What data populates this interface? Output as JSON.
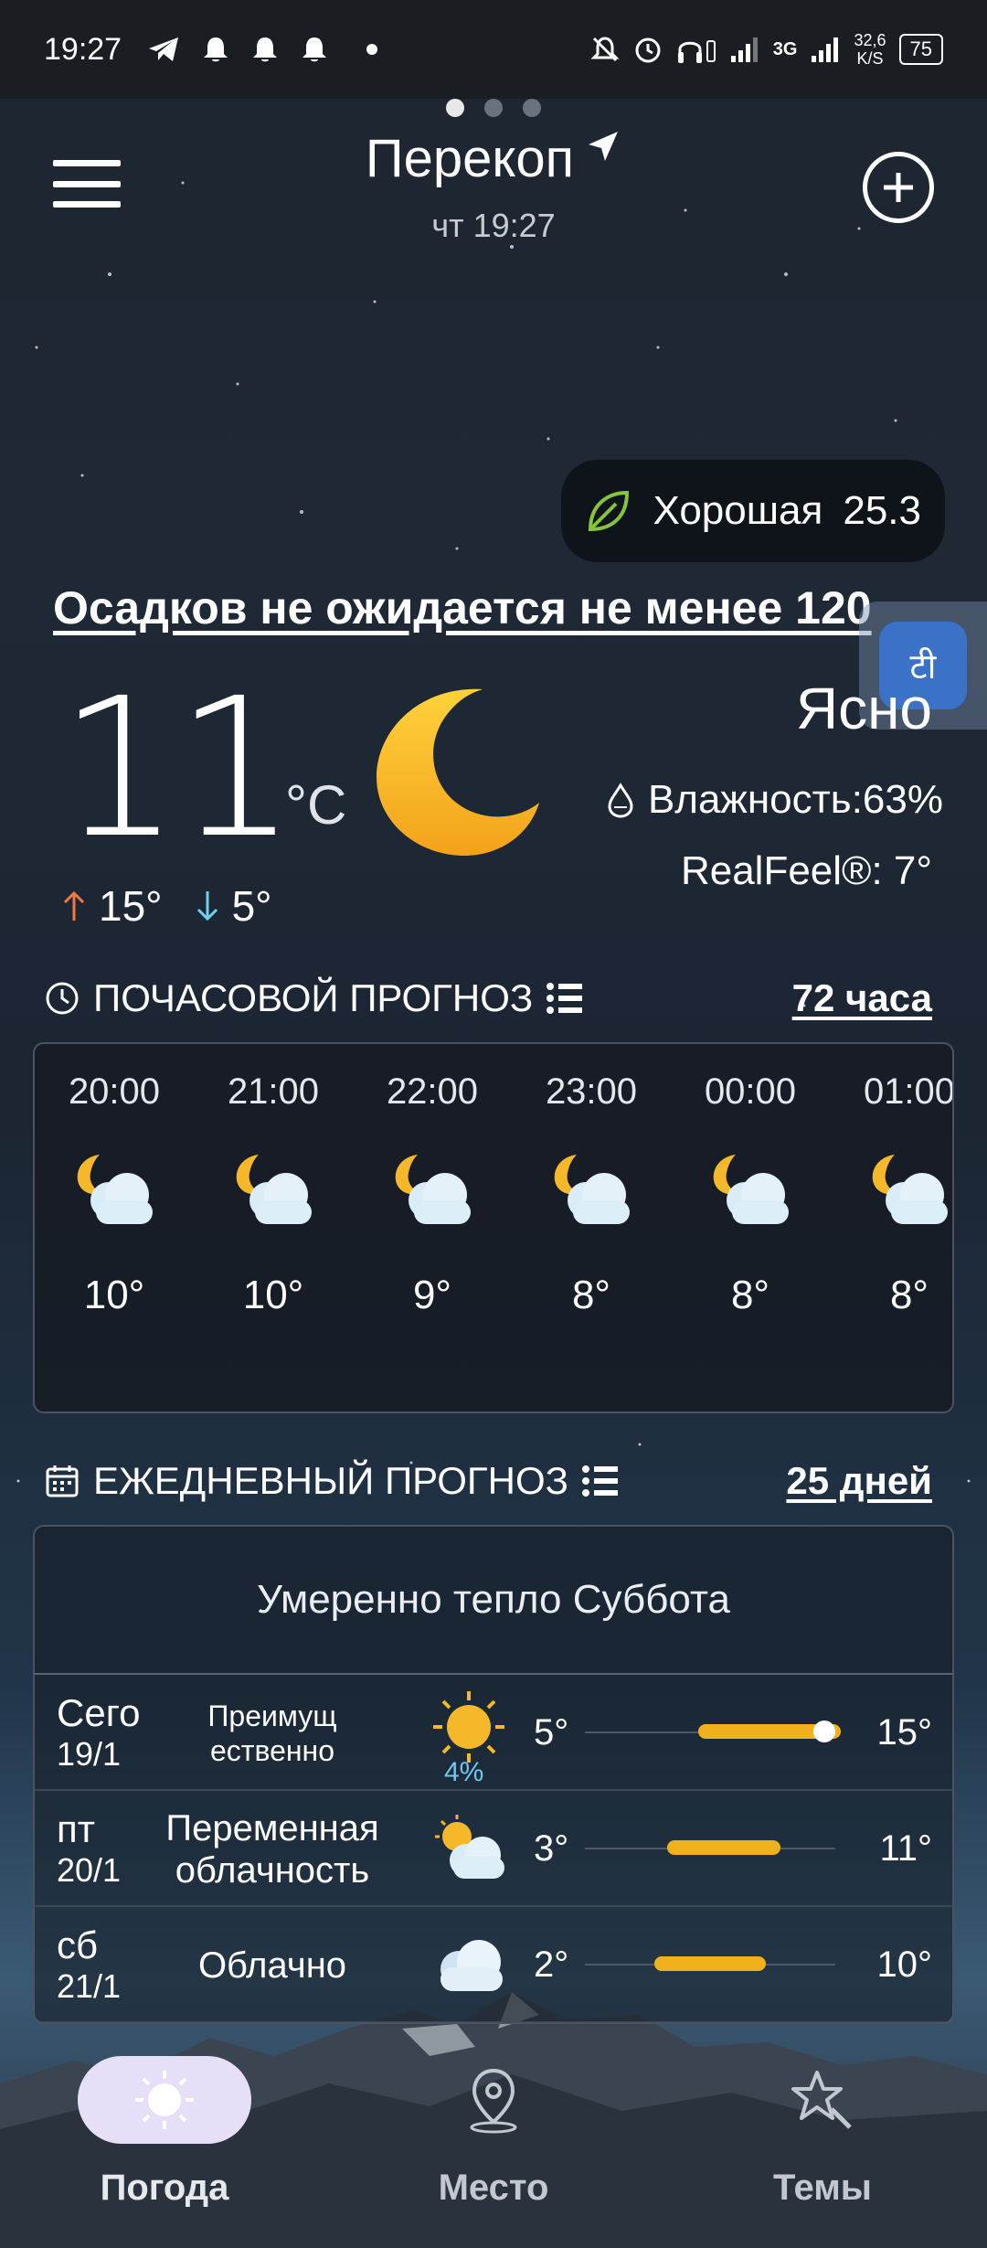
{
  "status_bar": {
    "time": "19:27",
    "network": "3G",
    "speed": "32,6",
    "speed_unit": "K/S",
    "battery": "75"
  },
  "header": {
    "city": "Перекоп",
    "datetime": "чт 19:27",
    "pages": 3
  },
  "air_quality": {
    "label": "Хорошая",
    "value": "25.3",
    "icon": "leaf-icon"
  },
  "precipitation_text": "Осадков не ожидается не менее 120",
  "current": {
    "temperature": "11",
    "unit": "°C",
    "condition": "Ясно",
    "humidity": "Влажность:63%",
    "realfeel": "RealFeel®: 7°",
    "max": "15°",
    "min": "5°",
    "icon": "moon-icon"
  },
  "hourly": {
    "title": "ПОЧАСОВОЙ ПРОГНОЗ",
    "link": "72 часа",
    "items": [
      {
        "time": "20:00",
        "temp": "10°"
      },
      {
        "time": "21:00",
        "temp": "10°"
      },
      {
        "time": "22:00",
        "temp": "9°"
      },
      {
        "time": "23:00",
        "temp": "8°"
      },
      {
        "time": "00:00",
        "temp": "8°"
      },
      {
        "time": "01:00",
        "temp": "8°"
      }
    ]
  },
  "daily": {
    "title": "ЕЖЕДНЕВНЫЙ ПРОГНОЗ",
    "link": "25 дней",
    "summary": "Умеренно тепло Суббота",
    "rows": [
      {
        "day": "Сего",
        "date": "19/1",
        "desc": "Преимущ ественно",
        "pop": "4%",
        "lo": "5°",
        "hi": "15°",
        "icon": "sun-icon"
      },
      {
        "day": "пт",
        "date": "20/1",
        "desc": "Переменная облачность",
        "lo": "3°",
        "hi": "11°",
        "icon": "partly-cloudy-icon"
      },
      {
        "day": "сб",
        "date": "21/1",
        "desc": "Облачно",
        "lo": "2°",
        "hi": "10°",
        "icon": "cloud-icon"
      }
    ]
  },
  "nav": {
    "weather": "Погода",
    "place": "Место",
    "themes": "Темы"
  },
  "colors": {
    "accent_bar": "#f1b11c",
    "nav_active": "#e7dff8",
    "max_arrow": "#f07a3f",
    "min_arrow": "#6fd0f2"
  }
}
